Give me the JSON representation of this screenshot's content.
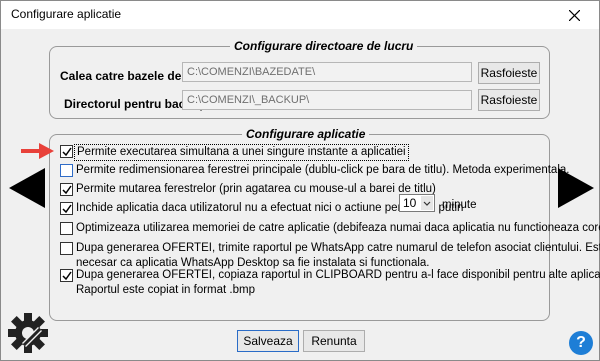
{
  "window": {
    "title": "Configurare aplicatie"
  },
  "directories": {
    "legend": "Configurare directoare de lucru",
    "db_path_label": "Calea catre bazele de date:",
    "db_path_value": "C:\\COMENZI\\BAZEDATE\\",
    "backup_label": "Directorul pentru backup:",
    "backup_value": "C:\\COMENZI\\_BACKUP\\",
    "browse_label": "Rasfoieste"
  },
  "app_config": {
    "legend": "Configurare aplicatie",
    "options": [
      {
        "label": "Permite executarea simultana a unei singure instante a aplicatiei",
        "checked": true
      },
      {
        "label": "Permite redimensionarea ferestrei principale (dublu-click pe bara de titlu). Metoda experimentala.",
        "checked": false
      },
      {
        "label": "Permite mutarea ferestrelor (prin agatarea cu mouse-ul a barei de titlu)",
        "checked": true
      },
      {
        "label": "Inchide aplicatia daca utilizatorul nu a efectuat nici o actiune pentru cel putin",
        "checked": true
      },
      {
        "label": "Optimizeaza utilizarea memoriei de catre aplicatie (debifeaza numai daca aplicatia nu functioneaza corect)",
        "checked": false
      },
      {
        "label": "Dupa generarea OFERTEI, trimite raportul pe WhatsApp catre numarul de telefon asociat clientului.  Este",
        "label2": "necesar ca aplicatia WhatsApp Desktop sa fie instalata si functionala.",
        "checked": false
      },
      {
        "label": "Dupa generarea OFERTEI, copiaza raportul in CLIPBOARD pentru a-l face disponibil pentru alte aplicatii.",
        "label2": "Raportul este copiat in format .bmp",
        "checked": true
      }
    ],
    "timeout_value": "10",
    "timeout_unit": "minute"
  },
  "footer": {
    "save_label": "Salveaza",
    "cancel_label": "Renunta"
  },
  "icons": {
    "close": "close-icon",
    "left": "arrow-left-icon",
    "right": "arrow-right-icon",
    "gear": "gear-icon",
    "help": "help-icon",
    "pointer": "red-arrow-icon"
  },
  "help_glyph": "?",
  "colors": {
    "accent": "#1e7ed6",
    "pointer": "#e8413a"
  }
}
